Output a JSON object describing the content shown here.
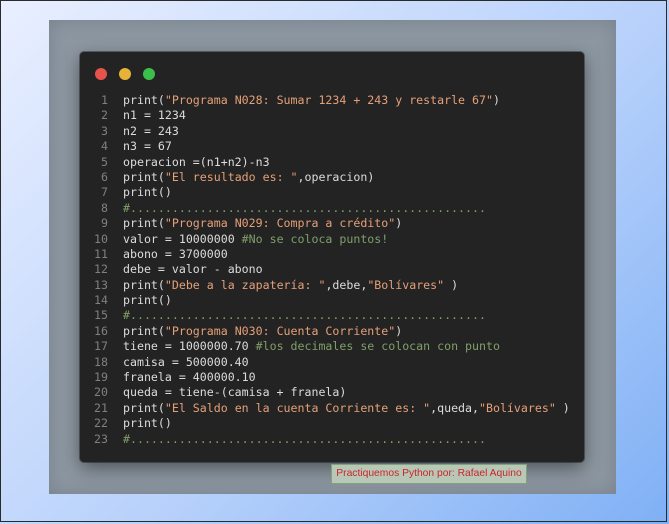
{
  "window": {
    "controls": [
      {
        "name": "close",
        "color": "#e5534b"
      },
      {
        "name": "minimize",
        "color": "#e8b23a"
      },
      {
        "name": "maximize",
        "color": "#3cbf4a"
      }
    ]
  },
  "colors": {
    "string": "#e5a078",
    "comment": "#7f9f6a",
    "text": "#dcdcdc",
    "line_number": "#808080"
  },
  "code": {
    "lines": [
      {
        "number": "1",
        "tokens": [
          {
            "t": "print(",
            "c": "plain"
          },
          {
            "t": "\"Programa N028: Sumar 1234 + 243 y restarle 67\"",
            "c": "str"
          },
          {
            "t": ")",
            "c": "plain"
          }
        ]
      },
      {
        "number": "2",
        "tokens": [
          {
            "t": "n1 = 1234",
            "c": "plain"
          }
        ]
      },
      {
        "number": "3",
        "tokens": [
          {
            "t": "n2 = 243",
            "c": "plain"
          }
        ]
      },
      {
        "number": "4",
        "tokens": [
          {
            "t": "n3 = 67",
            "c": "plain"
          }
        ]
      },
      {
        "number": "5",
        "tokens": [
          {
            "t": "operacion =(n1+n2)-n3",
            "c": "plain"
          }
        ]
      },
      {
        "number": "6",
        "tokens": [
          {
            "t": "print(",
            "c": "plain"
          },
          {
            "t": "\"El resultado es: \"",
            "c": "str"
          },
          {
            "t": ",operacion)",
            "c": "plain"
          }
        ]
      },
      {
        "number": "7",
        "tokens": [
          {
            "t": "print()",
            "c": "plain"
          }
        ]
      },
      {
        "number": "8",
        "tokens": [
          {
            "t": "#...................................................",
            "c": "cmt"
          }
        ]
      },
      {
        "number": "9",
        "tokens": [
          {
            "t": "print(",
            "c": "plain"
          },
          {
            "t": "\"Programa N029: Compra a crédito\"",
            "c": "str"
          },
          {
            "t": ")",
            "c": "plain"
          }
        ]
      },
      {
        "number": "10",
        "tokens": [
          {
            "t": "valor = 10000000 ",
            "c": "plain"
          },
          {
            "t": "#No se coloca puntos!",
            "c": "cmt"
          }
        ]
      },
      {
        "number": "11",
        "tokens": [
          {
            "t": "abono = 3700000",
            "c": "plain"
          }
        ]
      },
      {
        "number": "12",
        "tokens": [
          {
            "t": "debe = valor - abono",
            "c": "plain"
          }
        ]
      },
      {
        "number": "13",
        "tokens": [
          {
            "t": "print(",
            "c": "plain"
          },
          {
            "t": "\"Debe a la zapatería: \"",
            "c": "str"
          },
          {
            "t": ",debe,",
            "c": "plain"
          },
          {
            "t": "\"Bolívares\"",
            "c": "str"
          },
          {
            "t": " )",
            "c": "plain"
          }
        ]
      },
      {
        "number": "14",
        "tokens": [
          {
            "t": "print()",
            "c": "plain"
          }
        ]
      },
      {
        "number": "15",
        "tokens": [
          {
            "t": "#...................................................",
            "c": "cmt"
          }
        ]
      },
      {
        "number": "16",
        "tokens": [
          {
            "t": "print(",
            "c": "plain"
          },
          {
            "t": "\"Programa N030: Cuenta Corriente\"",
            "c": "str"
          },
          {
            "t": ")",
            "c": "plain"
          }
        ]
      },
      {
        "number": "17",
        "tokens": [
          {
            "t": "tiene = 1000000.70 ",
            "c": "plain"
          },
          {
            "t": "#los decimales se colocan con punto",
            "c": "cmt"
          }
        ]
      },
      {
        "number": "18",
        "tokens": [
          {
            "t": "camisa = 500000.40",
            "c": "plain"
          }
        ]
      },
      {
        "number": "19",
        "tokens": [
          {
            "t": "franela = 400000.10",
            "c": "plain"
          }
        ]
      },
      {
        "number": "20",
        "tokens": [
          {
            "t": "queda = tiene-(camisa + franela)",
            "c": "plain"
          }
        ]
      },
      {
        "number": "21",
        "tokens": [
          {
            "t": "print(",
            "c": "plain"
          },
          {
            "t": "\"El Saldo en la cuenta Corriente es: \"",
            "c": "str"
          },
          {
            "t": ",queda,",
            "c": "plain"
          },
          {
            "t": "\"Bolívares\"",
            "c": "str"
          },
          {
            "t": " )",
            "c": "plain"
          }
        ]
      },
      {
        "number": "22",
        "tokens": [
          {
            "t": "print()",
            "c": "plain"
          }
        ]
      },
      {
        "number": "23",
        "tokens": [
          {
            "t": "#...................................................",
            "c": "cmt"
          }
        ]
      }
    ]
  },
  "watermark": {
    "text": "Practiquemos Python por: Rafael Aquino"
  }
}
